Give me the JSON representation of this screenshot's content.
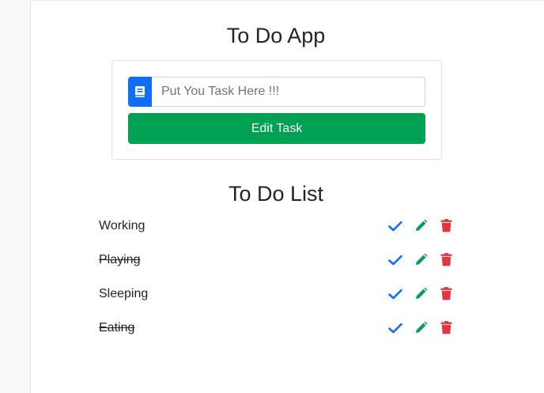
{
  "app": {
    "title": "To Do App"
  },
  "form": {
    "input_placeholder": "Put You Task Here !!!",
    "input_value": "",
    "submit_label": "Edit Task",
    "prepend_icon": "book-icon"
  },
  "list": {
    "title": "To Do List",
    "items": [
      {
        "label": "Working",
        "completed": false
      },
      {
        "label": "Playing",
        "completed": true
      },
      {
        "label": "Sleeping",
        "completed": false
      },
      {
        "label": "Eating",
        "completed": true
      }
    ],
    "item_actions": [
      "check-icon",
      "pencil-icon",
      "trash-icon"
    ]
  },
  "colors": {
    "primary": "#0d6efd",
    "success": "#00a152",
    "danger": "#e5343d"
  }
}
